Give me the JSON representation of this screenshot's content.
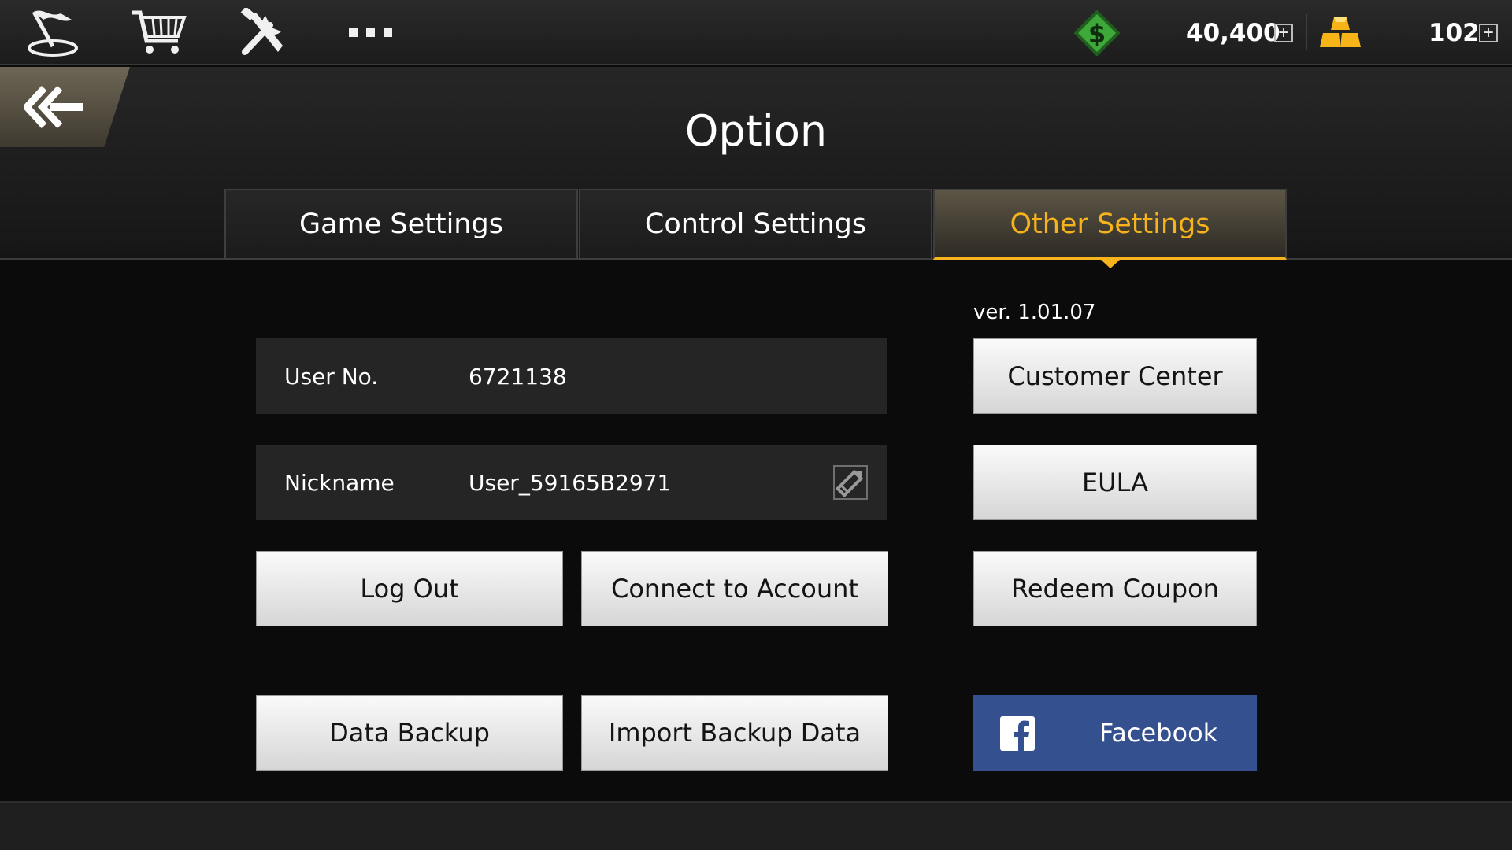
{
  "topbar": {
    "nav_icons": [
      "flag-icon",
      "shopping-cart-icon",
      "tools-icon",
      "more-icon"
    ],
    "cash": {
      "icon": "dollar-diamond-icon",
      "value": "40,400",
      "plus": "+"
    },
    "gold": {
      "icon": "gold-bars-icon",
      "value": "102",
      "plus": "+"
    }
  },
  "header": {
    "back_icon": "double-arrow-left-icon",
    "title": "Option"
  },
  "tabs": [
    {
      "label": "Game Settings",
      "active": false
    },
    {
      "label": "Control Settings",
      "active": false
    },
    {
      "label": "Other Settings",
      "active": true
    }
  ],
  "account": {
    "user_no_label": "User No.",
    "user_no_value": "6721138",
    "nickname_label": "Nickname",
    "nickname_value": "User_59165B2971",
    "edit_icon": "pencil-icon"
  },
  "buttons": {
    "log_out": "Log Out",
    "connect": "Connect to Account",
    "data_backup": "Data Backup",
    "import_backup": "Import Backup Data",
    "customer_center": "Customer Center",
    "eula": "EULA",
    "redeem_coupon": "Redeem Coupon",
    "facebook": "Facebook"
  },
  "version": "ver. 1.01.07",
  "colors": {
    "accent": "#f7b31b",
    "facebook": "#34508f",
    "cash_green": "#3fa83a"
  }
}
